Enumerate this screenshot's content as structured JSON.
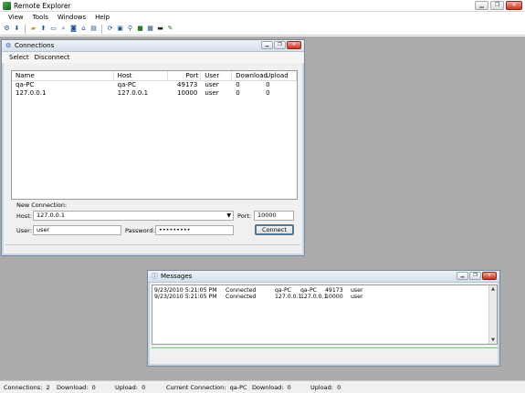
{
  "app": {
    "title": "Remote Explorer"
  },
  "menu": [
    "View",
    "Tools",
    "Windows",
    "Help"
  ],
  "toolbar_icons": [
    "connect-icon",
    "download-icon",
    "folder-icon",
    "upload-icon",
    "window-icon",
    "search-icon",
    "remote-icon",
    "network-icon",
    "settings-icon",
    "refresh-icon",
    "terminal-icon",
    "find-icon",
    "monitor-icon",
    "log-icon",
    "console-icon",
    "tools-icon"
  ],
  "connections_window": {
    "title": "Connections",
    "menu": [
      "Select",
      "Disconnect"
    ],
    "columns": [
      "Name",
      "Host",
      "Port",
      "User",
      "Download",
      "Upload"
    ],
    "rows": [
      {
        "name": "qa-PC",
        "host": "qa-PC",
        "port": "49173",
        "user": "user",
        "download": "0",
        "upload": "0"
      },
      {
        "name": "127.0.0.1",
        "host": "127.0.0.1",
        "port": "10000",
        "user": "user",
        "download": "0",
        "upload": "0"
      }
    ],
    "new_connection": {
      "section_label": "New Connection:",
      "host_label": "Host:",
      "host_value": "127.0.0.1",
      "port_label": "Port:",
      "port_value": "10000",
      "user_label": "User:",
      "user_value": "user",
      "password_label": "Password:",
      "password_value": "•••••••••",
      "connect_label": "Connect"
    }
  },
  "messages_window": {
    "title": "Messages",
    "rows": [
      {
        "time": "9/23/2010 5:21:05 PM",
        "status": "Connected",
        "h1": "qa-PC",
        "h2": "qa-PC",
        "port": "49173",
        "user": "user"
      },
      {
        "time": "9/23/2010 5:21:05 PM",
        "status": "Connected",
        "h1": "127.0.0.1",
        "h2": "127.0.0.1",
        "port": "10000",
        "user": "user"
      }
    ]
  },
  "status_bar": {
    "connections": "Connections:  2",
    "download": "Download:  0",
    "upload": "Upload:  0",
    "current": "Current Connection:  qa-PC",
    "cur_download": "Download:  0",
    "cur_upload": "Upload:  0"
  }
}
